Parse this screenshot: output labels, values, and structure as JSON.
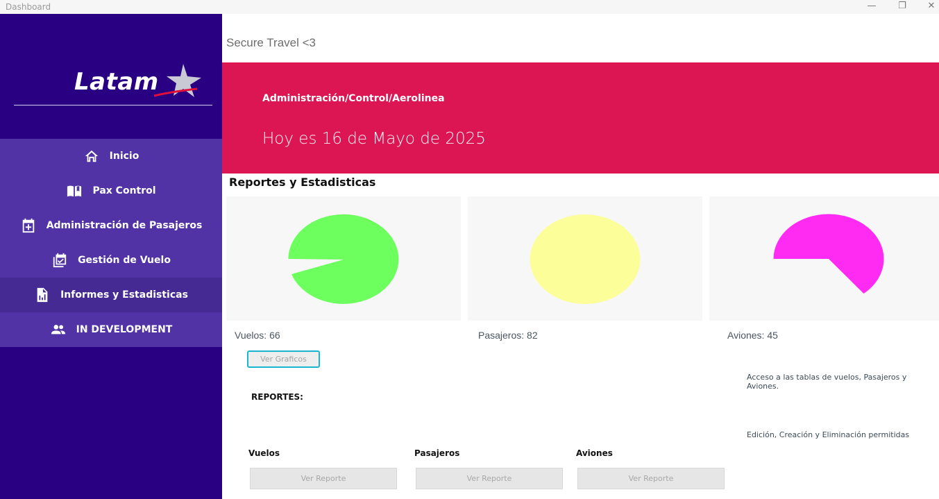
{
  "window": {
    "title": "Dashboard",
    "minimize": "—",
    "maximize": "❐",
    "close": "✕"
  },
  "sidebar": {
    "logo_text": "Latam",
    "items": [
      {
        "label": "Inicio",
        "icon": "home-icon"
      },
      {
        "label": "Pax Control",
        "icon": "book-icon"
      },
      {
        "label": "Administración de Pasajeros",
        "icon": "calendar-plus-icon"
      },
      {
        "label": "Gestión de Vuelo",
        "icon": "calendar-check-icon"
      },
      {
        "label": "Informes y Estadisticas",
        "icon": "report-icon",
        "active": true
      },
      {
        "label": "IN DEVELOPMENT",
        "icon": "people-icon"
      }
    ]
  },
  "header": {
    "brand": "Secure Travel <3"
  },
  "banner": {
    "path": "Administración/Control/Aerolinea",
    "date": "Hoy es 16 de Mayo de 2025"
  },
  "section": {
    "title": "Reportes y Estadisticas"
  },
  "stats": [
    {
      "label": "Vuelos: 66",
      "value": 66,
      "color": "#6dff5e"
    },
    {
      "label": "Pasajeros: 82",
      "value": 82,
      "color": "#fcff99"
    },
    {
      "label": "Aviones: 45",
      "value": 45,
      "color": "#ff2bf3"
    }
  ],
  "buttons": {
    "ver_graficos": "Ver Graficos",
    "ver_reporte": "Ver Reporte"
  },
  "info": {
    "line1": "Acceso a las tablas de vuelos, Pasajeros y Aviones.",
    "line2": "Edición, Creación y Eliminación permitidas"
  },
  "reportes": {
    "label": "REPORTES:",
    "items": [
      "Vuelos",
      "Pasajeros",
      "Aviones"
    ]
  },
  "colors": {
    "sidebar": "#2a0083",
    "menu": "#5133a5",
    "menu_active": "#452a93",
    "banner": "#dc1553",
    "accent": "#18b7cf"
  }
}
